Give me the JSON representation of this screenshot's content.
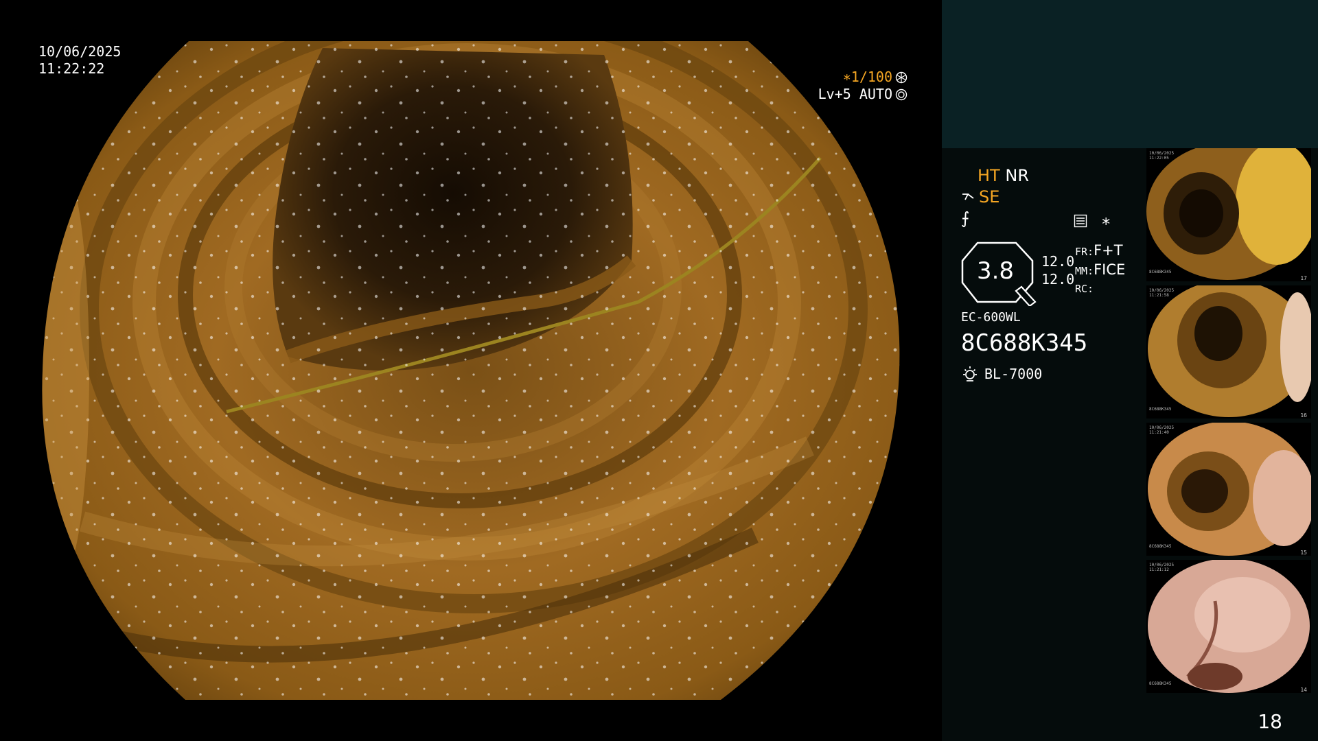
{
  "overlay": {
    "date": "10/06/2025",
    "time": "11:22:22",
    "shutter": "∗1/100",
    "iris": "Lv+5 AUTO"
  },
  "panel": {
    "ht": "HT",
    "nr": "NR",
    "se": "SE",
    "enhance_symbol": "⨍",
    "asterisk": "∗",
    "gauge_value": "3.8",
    "gauge_num1": "12.0",
    "gauge_num2": "12.0",
    "fr_label": "FR:",
    "fr_value": "F+T",
    "mm_label": "MM:",
    "mm_value": "FICE",
    "rc_label": "RC:",
    "scope_model": "EC-600WL",
    "serial": "8C688K345",
    "light_source": "BL-7000"
  },
  "thumbnails": [
    {
      "id": "17",
      "date": "10/06/2025",
      "time": "11:22:05",
      "serial": "8C688K345"
    },
    {
      "id": "16",
      "date": "10/06/2025",
      "time": "11:21:58",
      "serial": "8C688K345"
    },
    {
      "id": "15",
      "date": "10/06/2025",
      "time": "11:21:40",
      "serial": "8C688K345"
    },
    {
      "id": "14",
      "date": "10/06/2025",
      "time": "11:21:12",
      "serial": "8C688K345"
    }
  ],
  "page_number": "18",
  "colors": {
    "panel_top": "#0a2124",
    "panel_body": "#050c0c",
    "orange": "#f5a623"
  },
  "icons": [
    "shutter-icon",
    "iris-icon",
    "structure-enhance-icon",
    "image-settings-icon",
    "light-source-icon"
  ]
}
